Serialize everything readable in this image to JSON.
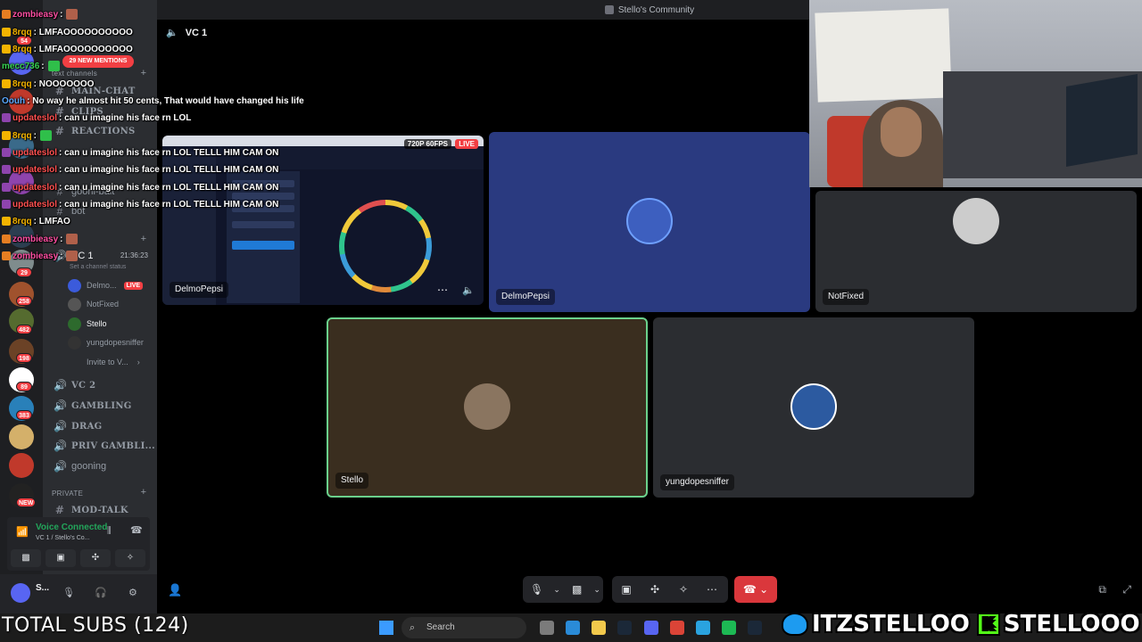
{
  "window": {
    "title": "Stello's Community"
  },
  "server_rail": {
    "badges": [
      "54",
      "29",
      "258",
      "482",
      "198",
      "89",
      "383",
      "NEW"
    ]
  },
  "sidebar": {
    "new_mentions": "29 NEW MENTIONS",
    "text_category": "text channels",
    "channels_top": [
      {
        "label": "MAIN-CHAT",
        "bold": true
      },
      {
        "label": "CLIPS",
        "bold": true
      },
      {
        "label": "REACTIONS",
        "bold": true
      },
      {
        "label": "gooni-bait",
        "bold": false
      },
      {
        "label": "bot",
        "bold": false
      }
    ],
    "vc_label": "VC 1",
    "vc_time": "21:36:23",
    "set_status": "Set a channel status",
    "voice_users": [
      {
        "name": "Delmo...",
        "live": "LIVE"
      },
      {
        "name": "NotFixed"
      },
      {
        "name": "Stello"
      },
      {
        "name": "yungdopesniffer"
      }
    ],
    "invite": "Invite to V...",
    "channels_bottom": [
      {
        "label": "VC 2",
        "bold": true
      },
      {
        "label": "GAMBLING",
        "bold": true
      },
      {
        "label": "DRAG",
        "bold": true
      },
      {
        "label": "PRIV GAMBLI...",
        "bold": true
      },
      {
        "label": "gooning",
        "bold": false
      }
    ],
    "private_category": "PRIVATE",
    "mod_talk": "MOD-TALK",
    "voice_panel": {
      "status": "Voice Connected",
      "location": "VC 1 / Stello's Co..."
    },
    "user": {
      "name": "S..."
    }
  },
  "main": {
    "channel": "VC 1",
    "tiles": [
      {
        "name": "DelmoPepsi",
        "kind": "stream",
        "quality": "720P 60FPS",
        "live": "LIVE"
      },
      {
        "name": "DelmoPepsi",
        "kind": "avatar"
      },
      {
        "name": "NotFixed",
        "kind": "avatar"
      },
      {
        "name": "Stello",
        "kind": "avatar"
      },
      {
        "name": "yungdopesniffer",
        "kind": "avatar"
      }
    ]
  },
  "chat": [
    {
      "user": "zombieasy",
      "text": "",
      "color": "#ff4fa3"
    },
    {
      "user": "8rqq",
      "text": "LMFAOOOOOOOOOO",
      "color": "#f4b400"
    },
    {
      "user": "8rqq",
      "text": "LMFAOOOOOOOOOO",
      "color": "#f4b400"
    },
    {
      "user": "mecc736",
      "text": "",
      "color": "#39d353"
    },
    {
      "user": "8rqq",
      "text": "NOOOOOOO",
      "color": "#f4b400"
    },
    {
      "user": "Oouh",
      "text": "No way he almost hit 50 cents, That would have changed his life",
      "color": "#5aa9ff"
    },
    {
      "user": "updateslol",
      "text": "can u imagine his face rn LOL",
      "color": "#ff5050"
    },
    {
      "user": "8rqq",
      "text": "",
      "color": "#f4b400"
    },
    {
      "user": "updateslol",
      "text": "can u imagine his face rn LOL TELLL HIM CAM ON",
      "color": "#ff5050"
    },
    {
      "user": "updateslol",
      "text": "can u imagine his face rn LOL TELLL HIM CAM ON",
      "color": "#ff5050"
    },
    {
      "user": "updateslol",
      "text": "can u imagine his face rn LOL TELLL HIM CAM ON",
      "color": "#ff5050"
    },
    {
      "user": "updateslol",
      "text": "can u imagine his face rn LOL TELLL HIM CAM ON",
      "color": "#ff5050"
    },
    {
      "user": "8rqq",
      "text": "LMFAO",
      "color": "#f4b400"
    },
    {
      "user": "zombieasy",
      "text": "",
      "color": "#ff4fa3"
    },
    {
      "user": "zombieasy",
      "text": "",
      "color": "#ff4fa3"
    }
  ],
  "taskbar": {
    "search": "Search"
  },
  "overlay": {
    "total_subs": "TOTAL SUBS (124)",
    "twitter_handle": "ITZSTELLOO",
    "kick_handle": "STELLOOO",
    "kick_letter": "K"
  },
  "colors": {
    "accent_green": "#23a55a",
    "live_red": "#f23f43",
    "blurple": "#5865f2"
  }
}
